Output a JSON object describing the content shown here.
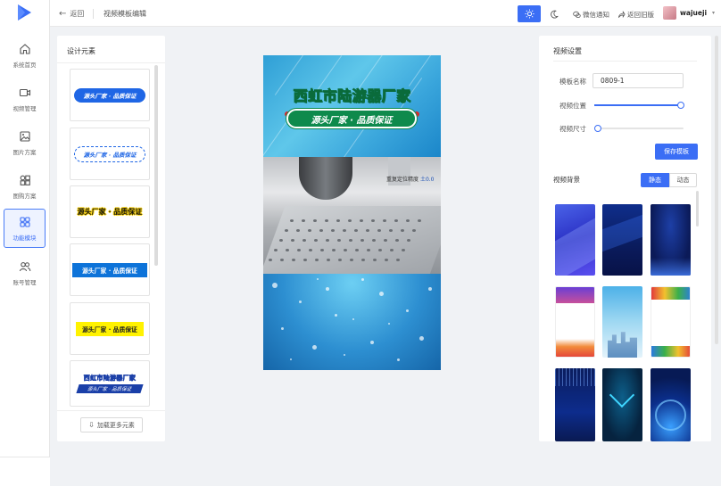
{
  "nav": {
    "items": [
      {
        "label": "系统首页",
        "icon": "home-icon"
      },
      {
        "label": "视频管理",
        "icon": "video-icon"
      },
      {
        "label": "图片方案",
        "icon": "image-icon"
      },
      {
        "label": "图购方案",
        "icon": "grid-icon"
      },
      {
        "label": "功能模块",
        "icon": "modules-icon",
        "active": true
      },
      {
        "label": "账号管理",
        "icon": "users-icon"
      }
    ]
  },
  "header": {
    "back_label": "返回",
    "breadcrumb": "视频模板编辑",
    "wechat_label": "微信通知",
    "old_version_label": "返回旧版",
    "username": "wajueji",
    "accent": "#3b6ef5"
  },
  "design": {
    "title": "设计元素",
    "elements": [
      {
        "style": "pill",
        "text": "源头厂家 · 品质保证"
      },
      {
        "style": "dashed",
        "text": "源头厂家 · 品质保证"
      },
      {
        "style": "yellow-outline",
        "text": "源头厂家 · 品质保证"
      },
      {
        "style": "blue-box",
        "text": "源头厂家 · 品质保证"
      },
      {
        "style": "yellow-box",
        "text": "源头厂家 · 品质保证"
      },
      {
        "style": "combo",
        "text": "西虹市陆游器厂家",
        "sub": "源头厂家 · 品质保证"
      }
    ],
    "load_more": "加载更多元素"
  },
  "preview": {
    "title": "西虹市陆游器厂家",
    "banner": "源头厂家 · 品质保证",
    "mid_text": "重复定位精度",
    "mid_text2": "土0.0"
  },
  "settings": {
    "title": "视频设置",
    "name_label": "模板名称",
    "name_value": "0809-1",
    "position_label": "视频位置",
    "position_value": 0.97,
    "size_label": "视频尺寸",
    "size_value": 0.0,
    "save_label": "保存模板",
    "bg_label": "视频背景",
    "seg_static": "静态",
    "seg_dynamic": "动态"
  }
}
